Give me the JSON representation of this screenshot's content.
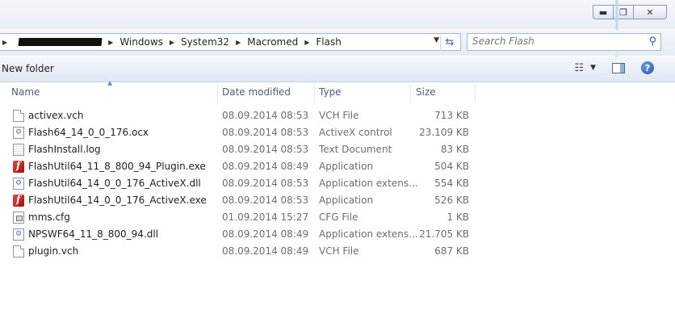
{
  "address": {
    "crumbs": [
      "Windows",
      "System32",
      "Macromed",
      "Flash"
    ]
  },
  "search": {
    "placeholder": "Search Flash"
  },
  "toolbar": {
    "new_folder": "New folder"
  },
  "columns": {
    "name": "Name",
    "date": "Date modified",
    "type": "Type",
    "size": "Size"
  },
  "files": [
    {
      "icon": "document-icon",
      "name": "activex.vch",
      "date": "08.09.2014 08:53",
      "type": "VCH File",
      "size": "713 KB"
    },
    {
      "icon": "gear-file-icon",
      "name": "Flash64_14_0_0_176.ocx",
      "date": "08.09.2014 08:53",
      "type": "ActiveX control",
      "size": "23.109 KB"
    },
    {
      "icon": "text-file-icon",
      "name": "FlashInstall.log",
      "date": "08.09.2014 08:53",
      "type": "Text Document",
      "size": "83 KB"
    },
    {
      "icon": "flash-icon",
      "name": "FlashUtil64_11_8_800_94_Plugin.exe",
      "date": "08.09.2014 08:49",
      "type": "Application",
      "size": "504 KB"
    },
    {
      "icon": "gear-file-icon",
      "name": "FlashUtil64_14_0_0_176_ActiveX.dll",
      "date": "08.09.2014 08:53",
      "type": "Application extens...",
      "size": "554 KB"
    },
    {
      "icon": "flash-icon",
      "name": "FlashUtil64_14_0_0_176_ActiveX.exe",
      "date": "08.09.2014 08:53",
      "type": "Application",
      "size": "526 KB"
    },
    {
      "icon": "config-file-icon",
      "name": "mms.cfg",
      "date": "01.09.2014 15:27",
      "type": "CFG File",
      "size": "1 KB"
    },
    {
      "icon": "gear-file-icon",
      "name": "NPSWF64_11_8_800_94.dll",
      "date": "08.09.2014 08:49",
      "type": "Application extens...",
      "size": "21.705 KB"
    },
    {
      "icon": "document-icon",
      "name": "plugin.vch",
      "date": "08.09.2014 08:49",
      "type": "VCH File",
      "size": "687 KB"
    }
  ]
}
